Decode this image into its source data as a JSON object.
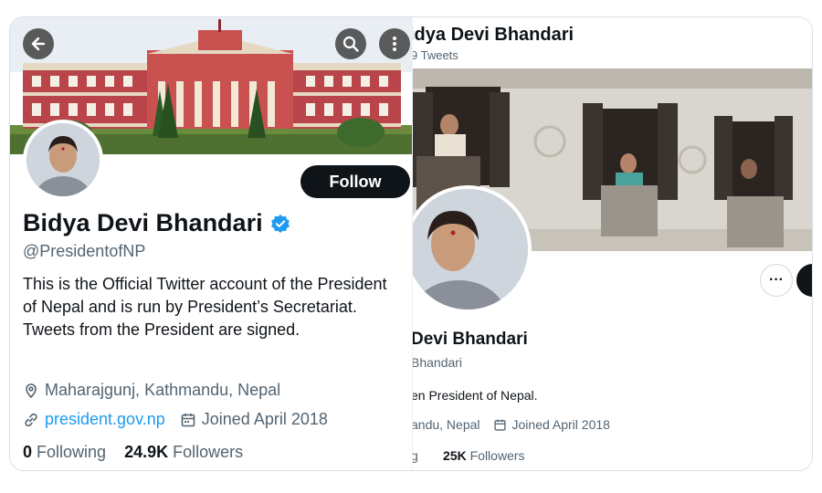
{
  "left_profile": {
    "name": "Bidya Devi Bhandari",
    "handle": "@PresidentofNP",
    "bio": "This is the Official Twitter account of the President of Nepal and is run by President’s Secretariat. Tweets from the President are signed.",
    "location": "Maharajgunj, Kathmandu, Nepal",
    "website": "president.gov.np",
    "joined": "Joined April 2018",
    "following_count": "0",
    "following_label": "Following",
    "followers_count": "24.9K",
    "followers_label": "Followers",
    "follow_label": "Follow",
    "icons": [
      "back-arrow-icon",
      "search-icon",
      "more-vertical-icon",
      "verified-badge-icon",
      "location-pin-icon",
      "link-icon",
      "calendar-icon"
    ],
    "verified_color": "#1d9bf0"
  },
  "right_profile": {
    "title": "idya Devi Bhandari",
    "tweet_count": "9 Tweets",
    "name": "Devi Bhandari",
    "handle": "Bhandari",
    "bio": "en President of Nepal.",
    "location": "andu, Nepal",
    "joined": "Joined April 2018",
    "following_stub": "g",
    "followers_count": "25K",
    "followers_label": "Followers",
    "more_label": "···"
  },
  "colors": {
    "accent": "#1d9bf0",
    "text": "#0f1419",
    "secondary": "#536471",
    "button_dark": "#0f1419"
  }
}
